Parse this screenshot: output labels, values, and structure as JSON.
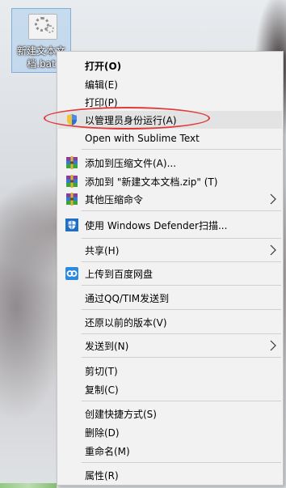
{
  "desktop": {
    "file_name": "新建文本文档.bat"
  },
  "menu": {
    "items": [
      {
        "label": "打开(O)"
      },
      {
        "label": "编辑(E)"
      },
      {
        "label": "打印(P)"
      },
      {
        "label": "以管理员身份运行(A)"
      },
      {
        "label": "Open with Sublime Text"
      },
      {
        "label": "添加到压缩文件(A)..."
      },
      {
        "label": "添加到 \"新建文本文档.zip\" (T)"
      },
      {
        "label": "其他压缩命令"
      },
      {
        "label": "使用 Windows Defender扫描..."
      },
      {
        "label": "共享(H)"
      },
      {
        "label": "上传到百度网盘"
      },
      {
        "label": "通过QQ/TIM发送到"
      },
      {
        "label": "还原以前的版本(V)"
      },
      {
        "label": "发送到(N)"
      },
      {
        "label": "剪切(T)"
      },
      {
        "label": "复制(C)"
      },
      {
        "label": "创建快捷方式(S)"
      },
      {
        "label": "删除(D)"
      },
      {
        "label": "重命名(M)"
      },
      {
        "label": "属性(R)"
      }
    ]
  },
  "colors": {
    "annotation": "#e03a3a",
    "menu_bg": "#f2f2f2",
    "hover_bg": "#e3e3e3"
  },
  "icons": [
    "gear-file-icon",
    "uac-shield-icon",
    "winrar-icon",
    "defender-icon",
    "baidu-netdisk-icon",
    "chevron-right-icon"
  ]
}
